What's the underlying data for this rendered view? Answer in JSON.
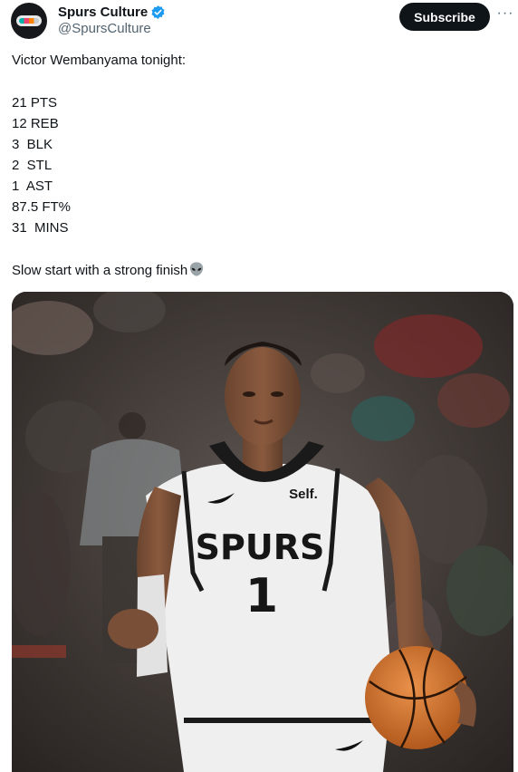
{
  "account": {
    "display_name": "Spurs Culture",
    "handle": "@SpursCulture",
    "verified": true,
    "avatar_logo_text": "SPURS"
  },
  "header": {
    "subscribe_label": "Subscribe",
    "more_label": "···"
  },
  "tweet": {
    "lines": [
      "Victor Wembanyama tonight:",
      "21 PTS",
      "12 REB",
      "3  BLK",
      "2  STL",
      "1  AST",
      "87.5 FT%",
      "31  MINS",
      "Slow start with a strong finish"
    ],
    "emoji": "alien-icon"
  },
  "media": {
    "jersey_wordmark": "SPURS",
    "jersey_number": "1",
    "jersey_sponsor": "Self."
  },
  "colors": {
    "text": "#0f1419",
    "secondary": "#536471",
    "verified_blue": "#1d9bf0",
    "subscribe_bg": "#0f1419"
  }
}
